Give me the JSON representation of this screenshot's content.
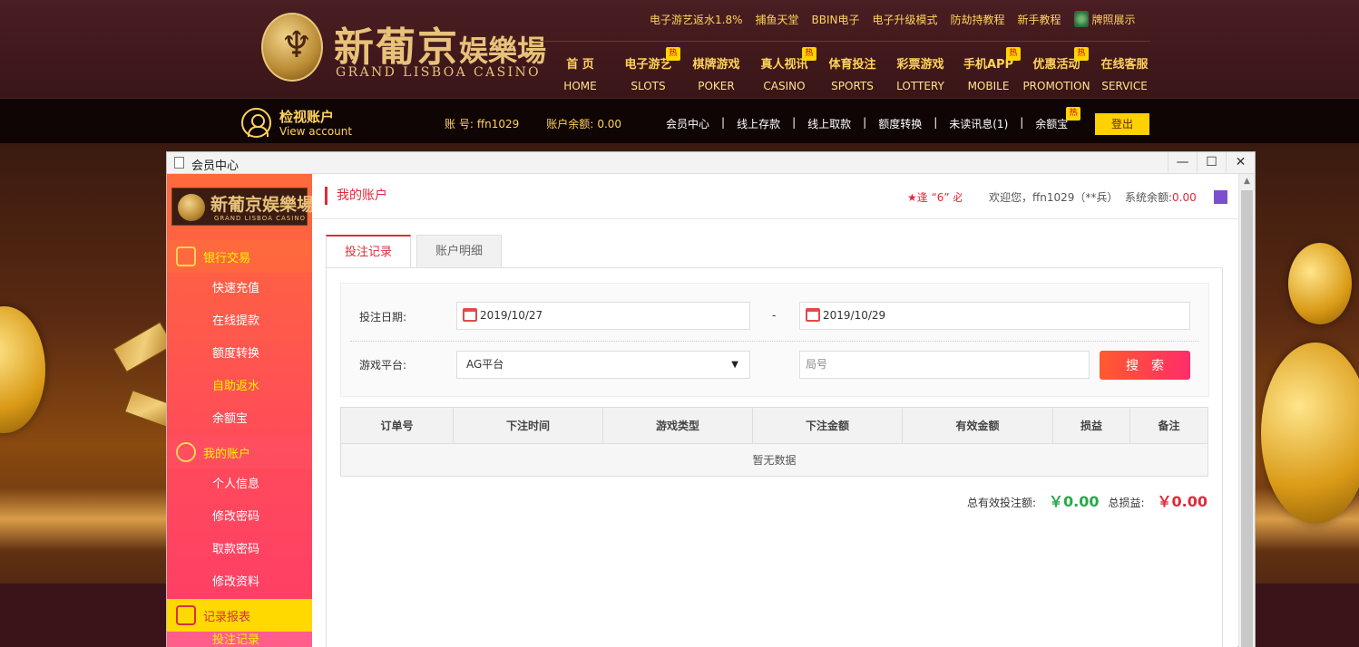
{
  "header": {
    "logo_cn": "新葡京",
    "logo_cn_small": "娱樂場",
    "logo_en": "GRAND LISBOA CASINO",
    "toplinks": [
      "电子游艺返水1.8%",
      "捕鱼天堂",
      "BBIN电子",
      "电子升级模式",
      "防劫持教程",
      "新手教程",
      "牌照展示"
    ],
    "nav": [
      {
        "cn": "首 页",
        "en": "HOME",
        "hot": false
      },
      {
        "cn": "电子游艺",
        "en": "SLOTS",
        "hot": true
      },
      {
        "cn": "棋牌游戏",
        "en": "POKER",
        "hot": false
      },
      {
        "cn": "真人视讯",
        "en": "CASINO",
        "hot": true
      },
      {
        "cn": "体育投注",
        "en": "SPORTS",
        "hot": false
      },
      {
        "cn": "彩票游戏",
        "en": "LOTTERY",
        "hot": false
      },
      {
        "cn": "手机APP",
        "en": "MOBILE",
        "hot": true
      },
      {
        "cn": "优惠活动",
        "en": "PROMOTION",
        "hot": true
      },
      {
        "cn": "在线客服",
        "en": "SERVICE",
        "hot": false
      }
    ],
    "hot_label": "热"
  },
  "account_bar": {
    "title_cn": "检视账户",
    "title_en": "View account",
    "account_label": "账 号:",
    "account_value": "ffn1029",
    "balance_label": "账户余额:",
    "balance_value": "0.00",
    "links": [
      "会员中心",
      "线上存款",
      "线上取款",
      "额度转换",
      "未读讯息(1)",
      "余额宝"
    ],
    "separator": "|",
    "logout": "登出"
  },
  "dialog": {
    "title": "会员中心",
    "controls": {
      "minimize": "—",
      "maximize": "☐",
      "close": "✕"
    }
  },
  "sidebar": {
    "logo_cn": "新葡京娱樂場",
    "logo_en": "GRAND LISBOA CASINO",
    "groups": [
      {
        "label": "银行交易",
        "items": [
          "快速充值",
          "在线提款",
          "额度转换",
          "自助返水",
          "余额宝"
        ]
      },
      {
        "label": "我的账户",
        "items": [
          "个人信息",
          "修改密码",
          "取款密码",
          "修改资料"
        ]
      },
      {
        "label": "记录报表",
        "items": [
          "投注记录"
        ]
      }
    ]
  },
  "content": {
    "page_title": "我的账户",
    "marquee": "★逢 “6” 必",
    "welcome": "欢迎您，ffn1029（**兵）",
    "system_balance_label": "系统余额:",
    "system_balance_value": "0.00",
    "tabs": [
      "投注记录",
      "账户明细"
    ],
    "filter": {
      "date_label": "投注日期:",
      "date_from": "2019/10/27",
      "date_sep": "-",
      "date_to": "2019/10/29",
      "platform_label": "游戏平台:",
      "platform_value": "AG平台",
      "round_placeholder": "局号",
      "search_button": "搜索"
    },
    "table": {
      "columns": [
        "订单号",
        "下注时间",
        "游戏类型",
        "下注金额",
        "有效金额",
        "损益",
        "备注"
      ],
      "empty_text": "暂无数据"
    },
    "totals": {
      "valid_bet_label": "总有效投注额:",
      "valid_bet_value": "￥0.00",
      "profit_label": "总损益:",
      "profit_value": "￥0.00"
    }
  }
}
